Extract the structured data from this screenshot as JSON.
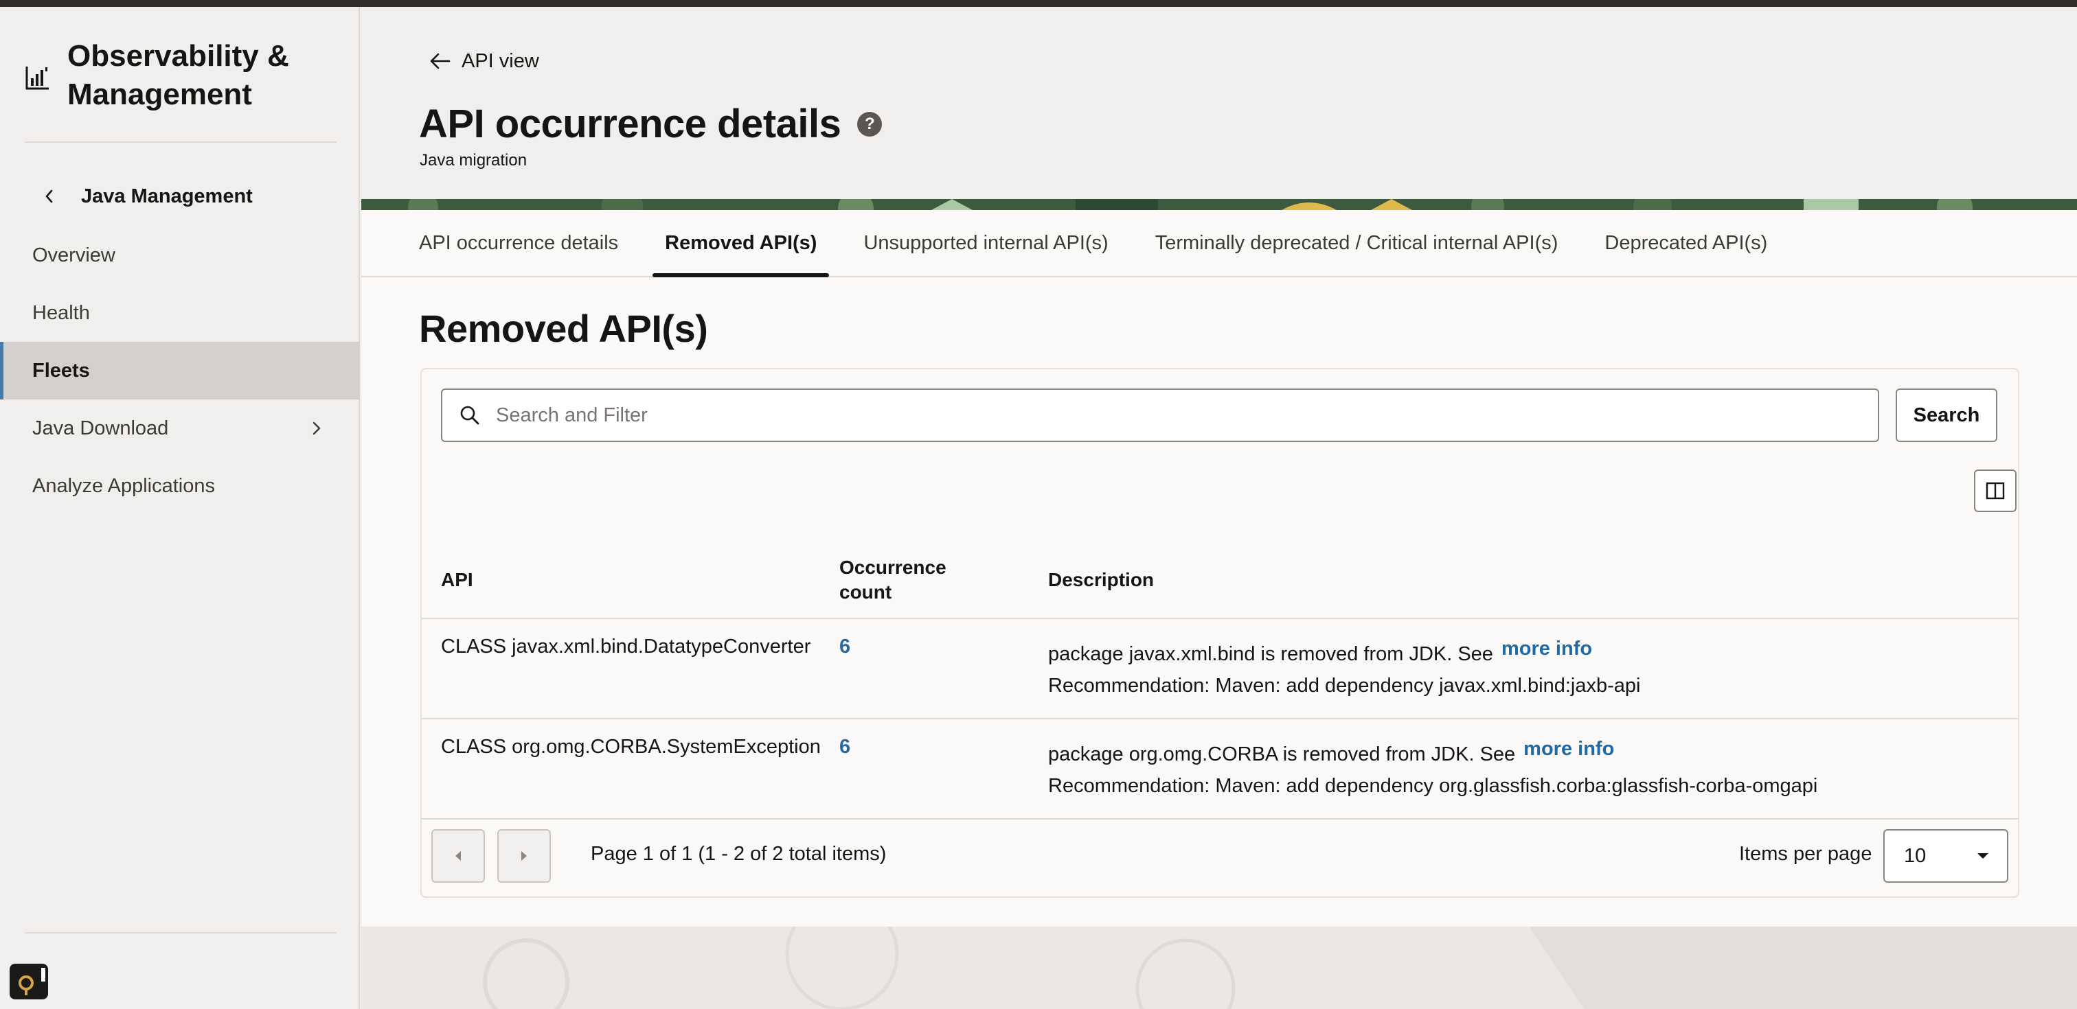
{
  "app": {
    "title": "Observability & Management"
  },
  "sidebar": {
    "back_module_label": "Java Management",
    "items": [
      {
        "label": "Overview"
      },
      {
        "label": "Health"
      },
      {
        "label": "Fleets"
      },
      {
        "label": "Java Download"
      },
      {
        "label": "Analyze Applications"
      }
    ],
    "active_item": "Fleets"
  },
  "header": {
    "back_link": "API view",
    "page_title": "API occurrence details",
    "subtitle": "Java migration"
  },
  "tabs": [
    {
      "label": "API occurrence details"
    },
    {
      "label": "Removed API(s)"
    },
    {
      "label": "Unsupported internal API(s)"
    },
    {
      "label": "Terminally deprecated / Critical internal API(s)"
    },
    {
      "label": "Deprecated API(s)"
    }
  ],
  "active_tab": "Removed API(s)",
  "section": {
    "title": "Removed API(s)"
  },
  "search": {
    "placeholder": "Search and Filter",
    "value": "",
    "button_label": "Search"
  },
  "table": {
    "columns": {
      "api": "API",
      "count_line1": "Occurrence",
      "count_line2": "count",
      "description": "Description"
    },
    "rows": [
      {
        "api": "CLASS javax.xml.bind.DatatypeConverter",
        "count": "6",
        "desc": "package javax.xml.bind is removed from JDK.  See",
        "link": "more info",
        "rec": "Recommendation: Maven: add dependency javax.xml.bind:jaxb-api"
      },
      {
        "api": "CLASS org.omg.CORBA.SystemException",
        "count": "6",
        "desc": "package org.omg.CORBA is removed from JDK.  See",
        "link": "more info",
        "rec": "Recommendation: Maven: add dependency org.glassfish.corba:glassfish-corba-omgapi"
      }
    ]
  },
  "pagination": {
    "status": "Page 1 of 1 (1 - 2 of 2 total items)",
    "items_per_page_label": "Items per page",
    "items_per_page_value": "10"
  },
  "colors": {
    "accent": "#4a7aa3",
    "link": "#1f6aa3",
    "banner": "#3e5a3e"
  }
}
